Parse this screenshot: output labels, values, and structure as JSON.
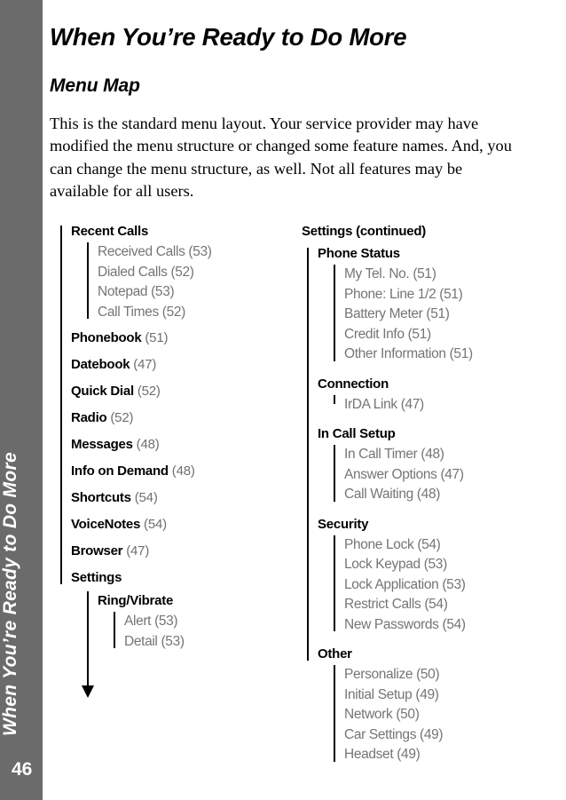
{
  "sidebar": {
    "tab_label": "When You’re Ready to Do More",
    "page_number": "46"
  },
  "header": {
    "chapter_title": "When You’re Ready to Do More",
    "section_title": "Menu Map",
    "intro_paragraph": "This is the standard menu layout. Your service provider may have modified the menu structure or changed some feature names. And, you can change the menu structure, as well. Not all features may be available for all users."
  },
  "menu_map": {
    "left_column": {
      "root_label": "Recent Calls",
      "root_children": [
        "Received Calls (53)",
        "Dialed Calls (52)",
        "Notepad (53)",
        "Call Times (52)"
      ],
      "entries": [
        {
          "name": "Phonebook",
          "page": "(51)"
        },
        {
          "name": "Datebook",
          "page": "(47)"
        },
        {
          "name": "Quick Dial",
          "page": "(52)"
        },
        {
          "name": "Radio",
          "page": "(52)"
        },
        {
          "name": "Messages",
          "page": "(48)"
        },
        {
          "name": "Info on Demand",
          "page": "(48)"
        },
        {
          "name": "Shortcuts",
          "page": "(54)"
        },
        {
          "name": "VoiceNotes",
          "page": "(54)"
        },
        {
          "name": "Browser",
          "page": "(47)"
        },
        {
          "name": "Settings",
          "page": ""
        }
      ],
      "settings_group": {
        "label": "Ring/Vibrate",
        "children": [
          "Alert (53)",
          "Detail (53)"
        ]
      }
    },
    "right_column": {
      "root_label": "Settings (continued)",
      "groups": [
        {
          "label": "Phone Status",
          "children": [
            "My Tel. No. (51)",
            "Phone: Line 1/2 (51)",
            "Battery Meter (51)",
            "Credit Info (51)",
            "Other Information (51)"
          ]
        },
        {
          "label": "Connection",
          "children": [
            "IrDA Link (47)"
          ]
        },
        {
          "label": "In Call Setup",
          "children": [
            "In Call Timer (48)",
            "Answer Options (47)",
            "Call Waiting (48)"
          ]
        },
        {
          "label": "Security",
          "children": [
            "Phone Lock (54)",
            "Lock Keypad (53)",
            "Lock Application (53)",
            "Restrict Calls (54)",
            "New Passwords (54)"
          ]
        },
        {
          "label": "Other",
          "children": [
            "Personalize (50)",
            "Initial Setup (49)",
            "Network (50)",
            "Car Settings (49)",
            "Headset (49)"
          ]
        }
      ]
    }
  },
  "colors": {
    "sidebar_gray": "#6b6b6b",
    "sub_entry_gray": "#757575",
    "ink": "#000000",
    "page_background": "#ffffff"
  }
}
